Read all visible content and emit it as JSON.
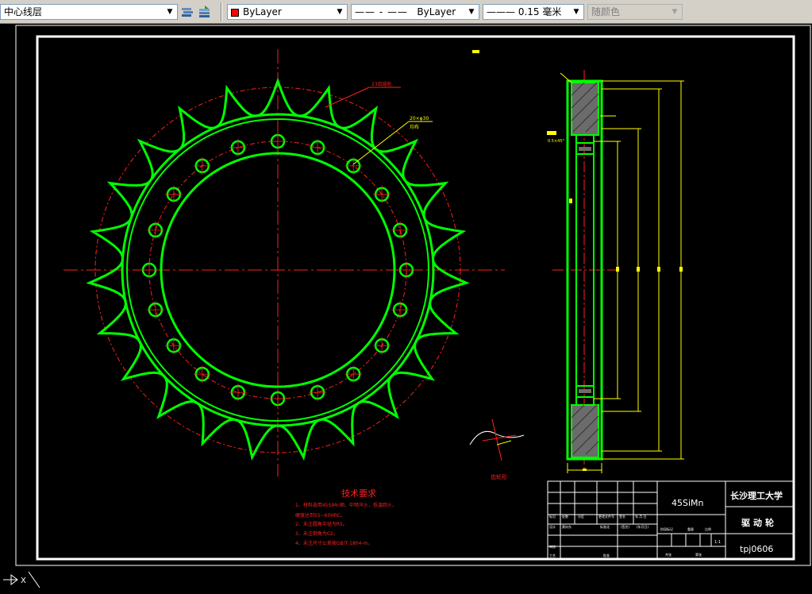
{
  "toolbar": {
    "layer": {
      "label": "中心线层",
      "color": "#ffffff"
    },
    "color_control": {
      "label": "ByLayer",
      "color": "#ff0000"
    },
    "linetype": {
      "label": "ByLayer"
    },
    "lineweight": {
      "label": "0.15 毫米"
    },
    "plotstyle": {
      "label": "随颜色"
    }
  },
  "drawing": {
    "tech_title": "技术要求",
    "tech_lines": [
      "1、材料选用45SiMn钢，中频淬火，低温回火，",
      "硬度达到55~60HRC。",
      "2、未注圆角半径为R5。",
      "3、未注倒角为C2。",
      "4、未注尺寸公差按GB/T 1804-m。"
    ],
    "callouts": [
      "23齿链轮",
      "20×φ30",
      "均布"
    ],
    "tooth_label": "齿轮形",
    "small_text": "0.5×45°",
    "title_block": {
      "material": "45SiMn",
      "school": "长沙理工大学",
      "part_name": "驱动轮",
      "drawing_no": "tpj0606",
      "scale": "1:1",
      "header_cells": [
        "标记",
        "处数",
        "分区",
        "更改文件号",
        "签名",
        "年.月.日"
      ],
      "row_labels": [
        "设计",
        "审核",
        "工艺"
      ],
      "sign_cells": [
        "黄向东",
        "标准化",
        "(签名)",
        "(年月日)"
      ],
      "stage_cells": [
        "阶段标记",
        "重量",
        "比例"
      ],
      "sheet_cells": [
        "共张",
        "第张"
      ],
      "approve": "批准"
    }
  },
  "status": {
    "ucs_label": "X"
  }
}
